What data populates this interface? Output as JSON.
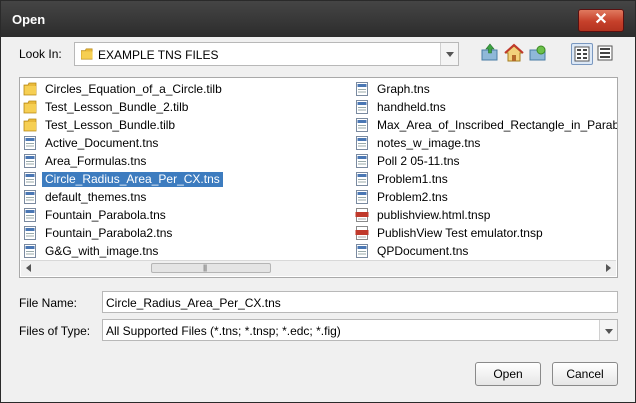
{
  "dialog": {
    "title": "Open",
    "close_glyph": "✕"
  },
  "look_in": {
    "label": "Look In:",
    "value": "EXAMPLE TNS FILES",
    "icon": "folder-icon"
  },
  "toolbar": {
    "buttons": [
      "up-one-level-icon",
      "home-icon",
      "create-new-folder-icon",
      "list-view-icon",
      "details-view-icon"
    ],
    "active_view": "list-view-icon"
  },
  "files": {
    "col1": [
      {
        "name": "Circles_Equation_of_a_Circle.tilb",
        "icon": "folder-icon"
      },
      {
        "name": "Test_Lesson_Bundle_2.tilb",
        "icon": "folder-icon"
      },
      {
        "name": "Test_Lesson_Bundle.tilb",
        "icon": "folder-icon"
      },
      {
        "name": "Active_Document.tns",
        "icon": "tns-file-icon"
      },
      {
        "name": "Area_Formulas.tns",
        "icon": "tns-file-icon"
      },
      {
        "name": "Circle_Radius_Area_Per_CX.tns",
        "icon": "tns-file-icon",
        "selected": true
      },
      {
        "name": "default_themes.tns",
        "icon": "tns-file-icon"
      },
      {
        "name": "Fountain_Parabola.tns",
        "icon": "tns-file-icon"
      },
      {
        "name": "Fountain_Parabola2.tns",
        "icon": "tns-file-icon"
      },
      {
        "name": "G&G_with_image.tns",
        "icon": "tns-file-icon"
      }
    ],
    "col2": [
      {
        "name": "Graph.tns",
        "icon": "tns-file-icon"
      },
      {
        "name": "handheld.tns",
        "icon": "tns-file-icon"
      },
      {
        "name": "Max_Area_of_Inscribed_Rectangle_in_Parab",
        "icon": "tns-file-icon"
      },
      {
        "name": "notes_w_image.tns",
        "icon": "tns-file-icon"
      },
      {
        "name": "Poll 2 05-11.tns",
        "icon": "tns-file-icon"
      },
      {
        "name": "Problem1.tns",
        "icon": "tns-file-icon"
      },
      {
        "name": "Problem2.tns",
        "icon": "tns-file-icon"
      },
      {
        "name": "publishview.html.tnsp",
        "icon": "tnsp-file-icon"
      },
      {
        "name": "PublishView Test emulator.tnsp",
        "icon": "tnsp-file-icon"
      },
      {
        "name": "QPDocument.tns",
        "icon": "tns-file-icon"
      }
    ]
  },
  "file_name": {
    "label": "File Name:",
    "value": "Circle_Radius_Area_Per_CX.tns"
  },
  "file_type": {
    "label": "Files of Type:",
    "value": "All Supported Files (*.tns; *.tnsp; *.edc; *.fig)"
  },
  "buttons": {
    "open": "Open",
    "cancel": "Cancel"
  },
  "colors": {
    "selection": "#3d7cbf",
    "titlebar": "#333333",
    "close": "#c6402a"
  }
}
